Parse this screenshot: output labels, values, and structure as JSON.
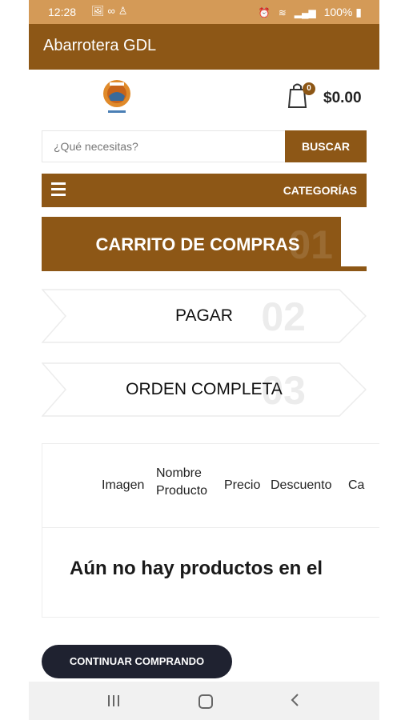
{
  "status_bar": {
    "time": "12:28",
    "battery": "100%"
  },
  "app_bar": {
    "title": "Abarrotera GDL"
  },
  "header": {
    "cart_count": "0",
    "cart_total": "$0.00"
  },
  "search": {
    "placeholder": "¿Qué necesitas?",
    "button": "BUSCAR"
  },
  "categories": {
    "label": "CATEGORÍAS"
  },
  "steps": [
    {
      "label": "CARRITO DE COMPRAS",
      "number": "01"
    },
    {
      "label": "PAGAR",
      "number": "02"
    },
    {
      "label": "ORDEN COMPLETA",
      "number": "03"
    }
  ],
  "table": {
    "headers": [
      "Imagen",
      "Nombre Producto",
      "Precio",
      "Descuento",
      "Ca"
    ],
    "empty_message": "Aún no hay productos en el"
  },
  "continue_button": "CONTINUAR COMPRANDO",
  "colors": {
    "brand": "#8d5716",
    "status_bar": "#d49a57",
    "button_dark": "#1f2230"
  }
}
